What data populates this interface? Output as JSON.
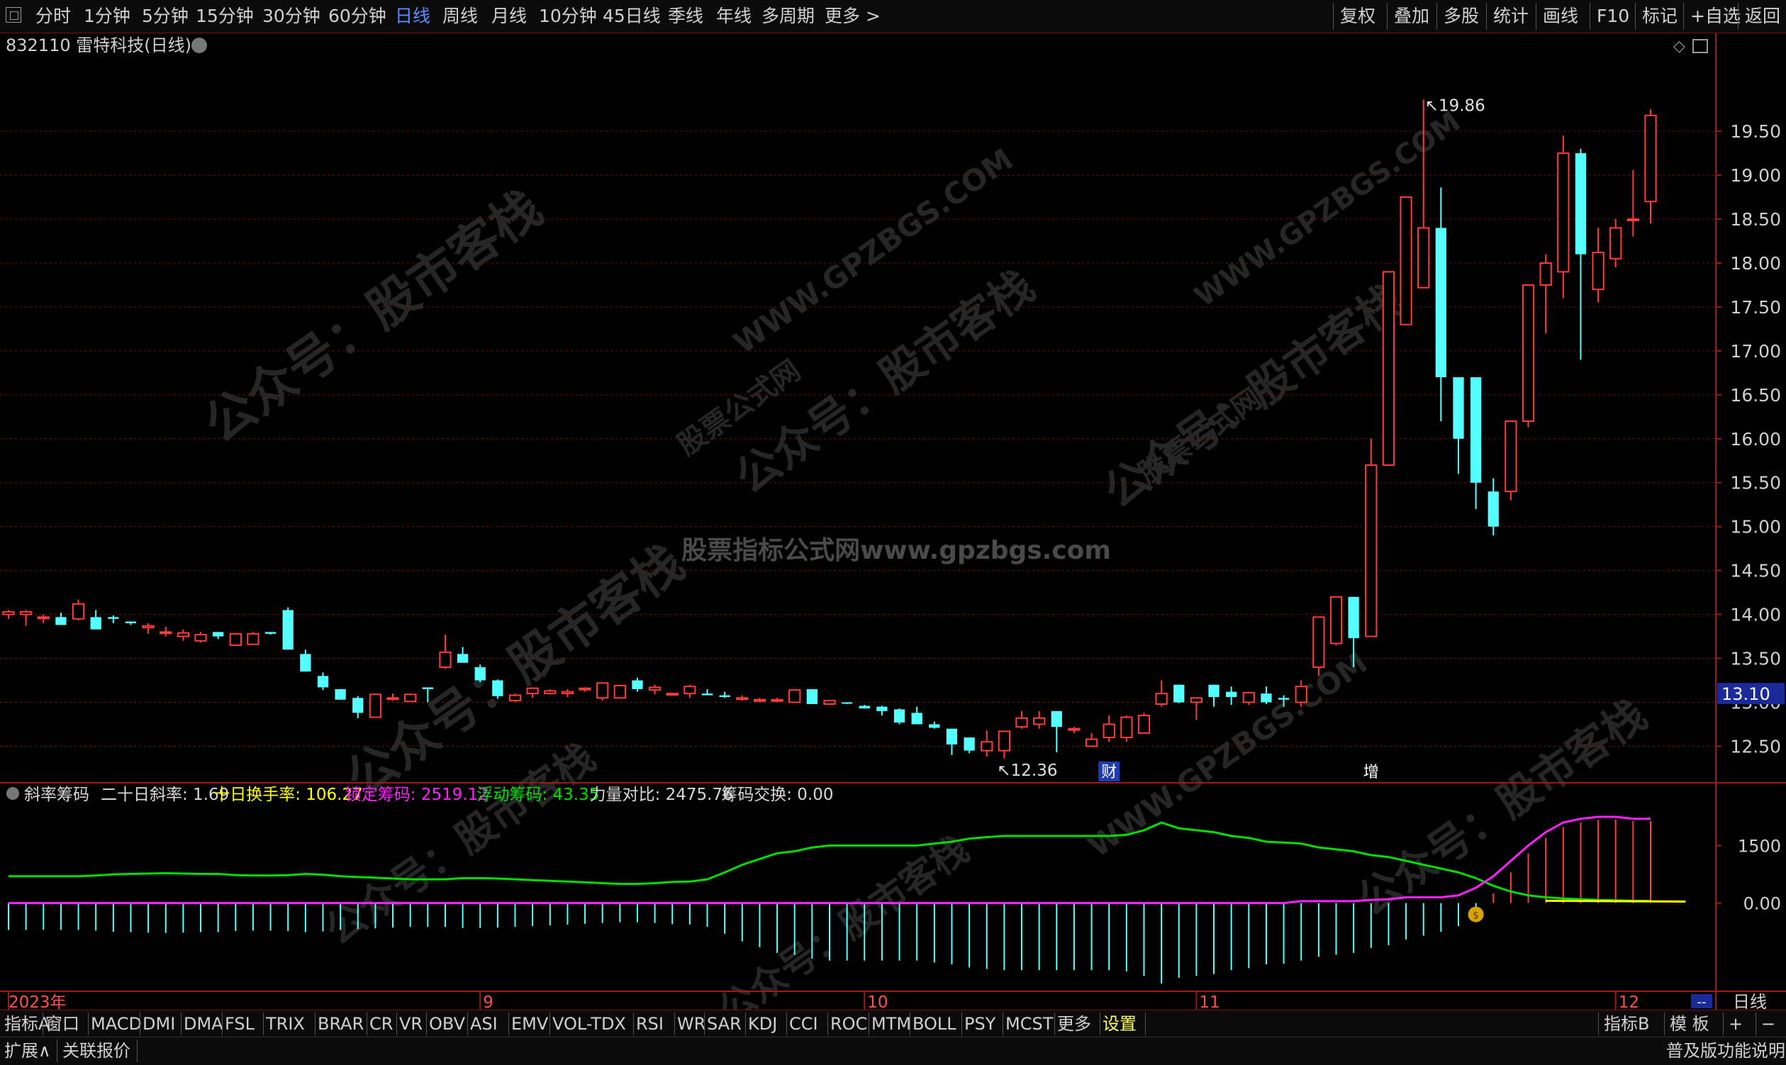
{
  "toolbar": {
    "periods": [
      {
        "label": "分时",
        "active": false
      },
      {
        "label": "1分钟",
        "active": false
      },
      {
        "label": "5分钟",
        "active": false
      },
      {
        "label": "15分钟",
        "active": false
      },
      {
        "label": "30分钟",
        "active": false
      },
      {
        "label": "60分钟",
        "active": false
      },
      {
        "label": "日线",
        "active": true
      },
      {
        "label": "周线",
        "active": false
      },
      {
        "label": "月线",
        "active": false
      },
      {
        "label": "10分钟",
        "active": false
      },
      {
        "label": "45日线",
        "active": false
      },
      {
        "label": "季线",
        "active": false
      },
      {
        "label": "年线",
        "active": false
      },
      {
        "label": "多周期",
        "active": false
      },
      {
        "label": "更多 >",
        "active": false
      }
    ],
    "right_buttons": [
      "复权",
      "叠加",
      "多股",
      "统计",
      "画线",
      "F10",
      "标记",
      "+自选",
      "返回"
    ]
  },
  "chart_header": {
    "code": "832110",
    "name_label": "雷特科技(日线)"
  },
  "watermarks": [
    "公众号：股市客栈",
    "股票公式网",
    "WWW.GPZBGS.COM",
    "股票指标公式网www.gpzbgs.com"
  ],
  "colors": {
    "up": "#ff3b3b",
    "down": "#54ffff",
    "grid": "#6b1515",
    "frame": "#9b1b1b",
    "green_line": "#00dd00",
    "magenta_line": "#ff22ff",
    "yellow": "#ffff00",
    "price_box": "#1a2a99"
  },
  "chart_data": [
    {
      "type": "candlestick",
      "title": "832110 雷特科技(日线)",
      "y_ticks": [
        "19.50",
        "19.00",
        "18.50",
        "18.00",
        "17.50",
        "17.00",
        "16.50",
        "16.00",
        "15.50",
        "15.00",
        "14.50",
        "14.00",
        "13.50",
        "13.00",
        "12.50"
      ],
      "ylim": [
        12.1,
        20.3
      ],
      "current_price": "13.10",
      "annotations": {
        "high": "19.86",
        "low": "12.36"
      },
      "event_markers": [
        {
          "label": "财",
          "index": 63
        },
        {
          "label": "增",
          "index": 78
        }
      ],
      "x_labels": [
        {
          "label": "2023年",
          "index": 0
        },
        {
          "label": "9",
          "index": 27
        },
        {
          "label": "10",
          "index": 49
        },
        {
          "label": "11",
          "index": 68
        },
        {
          "label": "12",
          "index": 92
        }
      ],
      "candles": [
        [
          14.0,
          14.05,
          13.95,
          14.03
        ],
        [
          14.0,
          14.05,
          13.87,
          14.03
        ],
        [
          13.97,
          14.0,
          13.9,
          13.97
        ],
        [
          13.97,
          14.02,
          13.9,
          13.88
        ],
        [
          13.95,
          14.17,
          13.93,
          14.12
        ],
        [
          13.97,
          14.05,
          13.83,
          13.83
        ],
        [
          13.97,
          13.99,
          13.9,
          13.95
        ],
        [
          13.92,
          13.92,
          13.88,
          13.9
        ],
        [
          13.85,
          13.9,
          13.78,
          13.87
        ],
        [
          13.8,
          13.86,
          13.75,
          13.8
        ],
        [
          13.75,
          13.83,
          13.7,
          13.79
        ],
        [
          13.7,
          13.8,
          13.68,
          13.77
        ],
        [
          13.8,
          13.8,
          13.72,
          13.75
        ],
        [
          13.65,
          13.79,
          13.65,
          13.78
        ],
        [
          13.66,
          13.8,
          13.66,
          13.78
        ],
        [
          13.8,
          13.8,
          13.77,
          13.78
        ],
        [
          14.05,
          14.08,
          13.6,
          13.6
        ],
        [
          13.55,
          13.6,
          13.35,
          13.35
        ],
        [
          13.3,
          13.34,
          13.14,
          13.17
        ],
        [
          13.15,
          13.15,
          13.03,
          13.03
        ],
        [
          13.05,
          13.07,
          12.82,
          12.88
        ],
        [
          12.83,
          13.1,
          12.83,
          13.09
        ],
        [
          13.05,
          13.1,
          13.02,
          13.05
        ],
        [
          13.01,
          13.1,
          13.01,
          13.09
        ],
        [
          13.17,
          13.17,
          13.0,
          13.15
        ],
        [
          13.4,
          13.77,
          13.38,
          13.57
        ],
        [
          13.55,
          13.63,
          13.45,
          13.45
        ],
        [
          13.4,
          13.43,
          13.23,
          13.25
        ],
        [
          13.25,
          13.26,
          13.04,
          13.07
        ],
        [
          13.02,
          13.1,
          13.0,
          13.08
        ],
        [
          13.1,
          13.17,
          13.05,
          13.16
        ],
        [
          13.1,
          13.15,
          13.09,
          13.13
        ],
        [
          13.1,
          13.15,
          13.06,
          13.12
        ],
        [
          13.15,
          13.17,
          13.12,
          13.16
        ],
        [
          13.05,
          13.22,
          13.02,
          13.22
        ],
        [
          13.05,
          13.2,
          13.05,
          13.19
        ],
        [
          13.25,
          13.28,
          13.12,
          13.15
        ],
        [
          13.14,
          13.2,
          13.09,
          13.17
        ],
        [
          13.1,
          13.11,
          13.09,
          13.1
        ],
        [
          13.1,
          13.2,
          13.05,
          13.18
        ],
        [
          13.1,
          13.15,
          13.08,
          13.08
        ],
        [
          13.08,
          13.12,
          13.05,
          13.06
        ],
        [
          13.05,
          13.08,
          13.02,
          13.05
        ],
        [
          13.03,
          13.05,
          13.0,
          13.03
        ],
        [
          13.02,
          13.05,
          13.0,
          13.03
        ],
        [
          13.0,
          13.15,
          13.0,
          13.14
        ],
        [
          13.15,
          13.15,
          12.98,
          12.98
        ],
        [
          12.98,
          13.02,
          12.98,
          13.02
        ],
        [
          13.0,
          13.0,
          12.98,
          12.99
        ],
        [
          12.96,
          12.97,
          12.93,
          12.93
        ],
        [
          12.95,
          12.96,
          12.85,
          12.9
        ],
        [
          12.92,
          12.93,
          12.75,
          12.77
        ],
        [
          12.88,
          12.95,
          12.75,
          12.75
        ],
        [
          12.75,
          12.78,
          12.7,
          12.71
        ],
        [
          12.7,
          12.7,
          12.4,
          12.52
        ],
        [
          12.6,
          12.6,
          12.42,
          12.45
        ],
        [
          12.45,
          12.68,
          12.38,
          12.55
        ],
        [
          12.45,
          12.65,
          12.36,
          12.67
        ],
        [
          12.72,
          12.9,
          12.7,
          12.82
        ],
        [
          12.75,
          12.9,
          12.7,
          12.82
        ],
        [
          12.9,
          12.9,
          12.43,
          12.72
        ],
        [
          12.7,
          12.72,
          12.65,
          12.7
        ],
        [
          12.5,
          12.65,
          12.49,
          12.58
        ],
        [
          12.6,
          12.85,
          12.55,
          12.75
        ],
        [
          12.6,
          12.85,
          12.55,
          12.83
        ],
        [
          12.65,
          12.88,
          12.65,
          12.85
        ],
        [
          12.98,
          13.25,
          12.95,
          13.1
        ],
        [
          13.2,
          13.2,
          12.99,
          13.0
        ],
        [
          13.0,
          13.05,
          12.8,
          13.05
        ],
        [
          13.2,
          13.2,
          12.95,
          13.06
        ],
        [
          13.12,
          13.18,
          12.97,
          13.06
        ],
        [
          13.0,
          13.12,
          12.97,
          13.11
        ],
        [
          13.1,
          13.18,
          12.98,
          13.0
        ],
        [
          13.05,
          13.08,
          12.95,
          13.03
        ],
        [
          13.0,
          13.25,
          12.95,
          13.18
        ],
        [
          13.4,
          13.75,
          13.3,
          13.97
        ],
        [
          13.67,
          14.2,
          13.65,
          14.2
        ],
        [
          14.2,
          14.2,
          13.4,
          13.73
        ],
        [
          13.75,
          16.0,
          13.75,
          15.7
        ],
        [
          15.7,
          16.55,
          15.7,
          17.9
        ],
        [
          17.3,
          17.38,
          17.35,
          18.75
        ],
        [
          17.72,
          19.86,
          17.9,
          18.4
        ],
        [
          18.4,
          18.86,
          16.2,
          16.7
        ],
        [
          16.7,
          16.55,
          15.6,
          16.0
        ],
        [
          16.7,
          16.3,
          15.2,
          15.5
        ],
        [
          15.4,
          15.55,
          14.9,
          15.0
        ],
        [
          15.4,
          15.85,
          15.3,
          16.2
        ],
        [
          16.2,
          17.0,
          16.13,
          17.75
        ],
        [
          17.75,
          18.1,
          17.2,
          18.0
        ],
        [
          17.9,
          19.45,
          17.6,
          19.25
        ],
        [
          19.25,
          19.3,
          16.9,
          18.1
        ],
        [
          17.7,
          18.4,
          17.55,
          18.12
        ],
        [
          18.05,
          18.5,
          17.95,
          18.4
        ],
        [
          18.5,
          19.06,
          18.3,
          18.5
        ],
        [
          18.7,
          19.75,
          18.45,
          19.68
        ]
      ]
    },
    {
      "type": "line",
      "title": "斜率筹码",
      "legend": [
        {
          "label": "二十日斜率: 1.69",
          "color": "#d8d8d8"
        },
        {
          "label": "十日换手率: 106.27",
          "color": "#ffff00"
        },
        {
          "label": "锁定筹码: 2519.12",
          "color": "#ff22ff"
        },
        {
          "label": "浮动筹码: 43.35",
          "color": "#00dd00"
        },
        {
          "label": "力量对比: 2475.76",
          "color": "#d8d8d8"
        },
        {
          "label": "筹码交换: 0.00",
          "color": "#d8d8d8"
        }
      ],
      "y_ticks": [
        "1500",
        "0.00"
      ],
      "ylim": [
        -2300,
        3100
      ],
      "series": [
        {
          "name": "浮动筹码",
          "values": [
            700,
            700,
            700,
            700,
            700,
            720,
            750,
            760,
            770,
            780,
            770,
            760,
            760,
            730,
            720,
            720,
            730,
            760,
            740,
            700,
            680,
            660,
            640,
            620,
            620,
            620,
            650,
            650,
            640,
            620,
            600,
            580,
            560,
            540,
            520,
            500,
            500,
            520,
            550,
            560,
            620,
            800,
            1000,
            1150,
            1300,
            1350,
            1450,
            1500,
            1500,
            1500,
            1500,
            1500,
            1500,
            1550,
            1600,
            1680,
            1720,
            1750,
            1750,
            1750,
            1750,
            1750,
            1750,
            1750,
            1780,
            1900,
            2100,
            1950,
            1900,
            1850,
            1750,
            1700,
            1600,
            1580,
            1550,
            1450,
            1400,
            1350,
            1250,
            1200,
            1100,
            1000,
            900,
            800,
            650,
            450,
            300,
            200,
            150,
            120,
            100,
            80,
            70,
            60,
            55,
            50,
            48,
            45,
            43
          ]
        },
        {
          "name": "锁定筹码",
          "values": [
            0,
            0,
            0,
            0,
            0,
            0,
            0,
            0,
            0,
            0,
            0,
            0,
            0,
            0,
            0,
            0,
            0,
            0,
            0,
            0,
            0,
            0,
            0,
            0,
            0,
            0,
            0,
            0,
            0,
            0,
            0,
            0,
            0,
            0,
            0,
            0,
            0,
            0,
            0,
            0,
            0,
            0,
            0,
            0,
            0,
            0,
            0,
            0,
            0,
            0,
            0,
            0,
            0,
            0,
            0,
            0,
            0,
            0,
            0,
            0,
            0,
            0,
            0,
            0,
            0,
            0,
            0,
            0,
            0,
            0,
            0,
            0,
            0,
            0,
            50,
            50,
            50,
            50,
            80,
            100,
            150,
            150,
            150,
            200,
            400,
            700,
            1100,
            1500,
            1850,
            2100,
            2200,
            2250,
            2250,
            2200,
            2200,
            2250,
            2350,
            2520,
            2550,
            2520,
            2520
          ]
        },
        {
          "name": "力量对比",
          "values": [
            -700,
            -700,
            -700,
            -700,
            -700,
            -720,
            -750,
            -760,
            -770,
            -780,
            -770,
            -760,
            -760,
            -730,
            -720,
            -720,
            -730,
            -760,
            -740,
            -700,
            -680,
            -660,
            -640,
            -620,
            -620,
            -620,
            -650,
            -650,
            -640,
            -620,
            -600,
            -580,
            -560,
            -540,
            -520,
            -500,
            -500,
            -520,
            -550,
            -560,
            -620,
            -800,
            -1000,
            -1150,
            -1300,
            -1350,
            -1450,
            -1500,
            -1500,
            -1500,
            -1500,
            -1500,
            -1500,
            -1550,
            -1600,
            -1680,
            -1720,
            -1750,
            -1750,
            -1750,
            -1750,
            -1750,
            -1750,
            -1750,
            -1780,
            -1900,
            -2100,
            -1950,
            -1900,
            -1850,
            -1750,
            -1700,
            -1600,
            -1580,
            -1500,
            -1400,
            -1350,
            -1300,
            -1170,
            -1100,
            -950,
            -850,
            -750,
            -600,
            -250,
            250,
            800,
            1300,
            1700,
            1980,
            2100,
            2170,
            2180,
            2140,
            2145,
            2200,
            2300,
            2475,
            2495,
            2470,
            2476
          ]
        }
      ]
    }
  ],
  "bottom_tabs": [
    "指标A",
    "窗口",
    "MACD",
    "DMI",
    "DMA",
    "FSL",
    "TRIX",
    "BRAR",
    "CR",
    "VR",
    "OBV",
    "ASI",
    "EMV",
    "VOL-TDX",
    "RSI",
    "WR",
    "SAR",
    "KDJ",
    "CCI",
    "ROC",
    "MTM",
    "BOLL",
    "PSY",
    "MCST",
    "更多",
    "设置"
  ],
  "bottom_right": [
    "指标B",
    "模 板",
    "+",
    "−"
  ],
  "right_period_label": "日线",
  "status": {
    "left1": "扩展∧",
    "left2": "关联报价",
    "right": "普及版功能说明"
  }
}
